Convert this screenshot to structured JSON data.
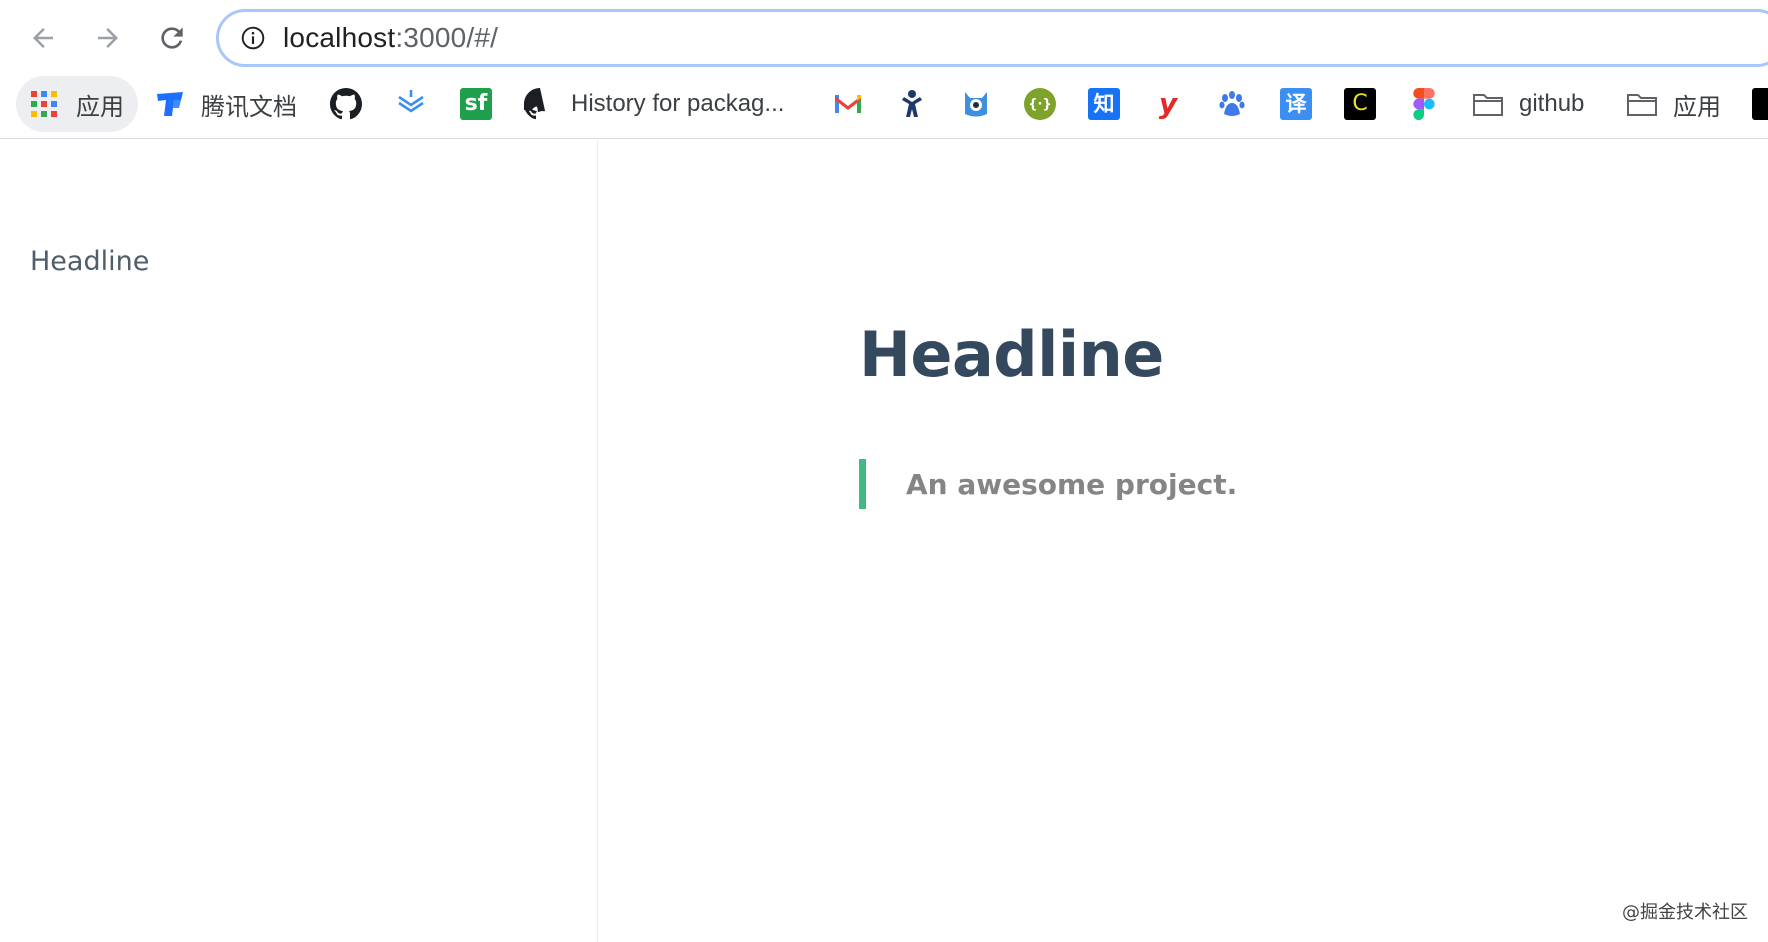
{
  "browser": {
    "url_host": "localhost",
    "url_rest": ":3000/#/",
    "bookmarks": [
      {
        "icon": "apps-grid-icon",
        "label": "应用"
      },
      {
        "icon": "tencent-docs-icon",
        "label": "腾讯文档"
      },
      {
        "icon": "github-icon",
        "label": ""
      },
      {
        "icon": "layers-icon",
        "label": ""
      },
      {
        "icon": "segmentfault-icon",
        "label": "",
        "glyph": "sf"
      },
      {
        "icon": "github-icon",
        "label": "History for packag..."
      },
      {
        "icon": "gmail-icon",
        "label": ""
      },
      {
        "icon": "jira-icon",
        "label": ""
      },
      {
        "icon": "monster-icon",
        "label": ""
      },
      {
        "icon": "curly-braces-icon",
        "label": "",
        "glyph": "{·}"
      },
      {
        "icon": "zhihu-icon",
        "label": "",
        "glyph": "知"
      },
      {
        "icon": "youdao-icon",
        "label": "",
        "glyph": "y"
      },
      {
        "icon": "baidu-paw-icon",
        "label": ""
      },
      {
        "icon": "translate-icon",
        "label": "",
        "glyph": "译"
      },
      {
        "icon": "copyright-icon",
        "label": "",
        "glyph": "C"
      },
      {
        "icon": "figma-icon",
        "label": ""
      },
      {
        "icon": "folder-icon",
        "label": "github"
      },
      {
        "icon": "folder-icon",
        "label": "应用"
      }
    ]
  },
  "sidebar": {
    "items": [
      {
        "label": "Headline"
      }
    ]
  },
  "main": {
    "title": "Headline",
    "quote": "An awesome project."
  },
  "watermark": "@掘金技术社区",
  "colors": {
    "heading": "#34495e",
    "accent": "#42b983",
    "quote_text": "#858585",
    "sidebar_text": "#505d6b"
  }
}
